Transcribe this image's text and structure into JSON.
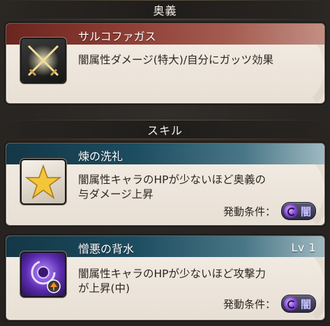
{
  "sections": {
    "ougi": {
      "header": "奥義",
      "card": {
        "title": "サルコファガス",
        "description": "闇属性ダメージ(特大)/自分にガッツ効果",
        "icon": "crossed-swords-icon"
      }
    },
    "skills": {
      "header": "スキル",
      "cards": [
        {
          "title": "煉の洗礼",
          "description_line1": "闇属性キャラのHPが少ないほど奥義の",
          "description_line2": "与ダメージ上昇",
          "condition_label": "発動条件：",
          "condition_element": "闇",
          "icon": "gold-star-icon"
        },
        {
          "title": "憎悪の背水",
          "level": "Lv 1",
          "description_line1": "闇属性キャラのHPが少ないほど攻撃力",
          "description_line2": "が上昇(中)",
          "condition_label": "発動条件：",
          "condition_element": "闇",
          "icon": "dark-swirl-icon"
        }
      ]
    }
  },
  "colors": {
    "ougi_bar": "#8c3c32",
    "skill_bar": "#1c4c5f",
    "dark_element": "#8a4fd6",
    "card_bg": "#f4eee6"
  }
}
